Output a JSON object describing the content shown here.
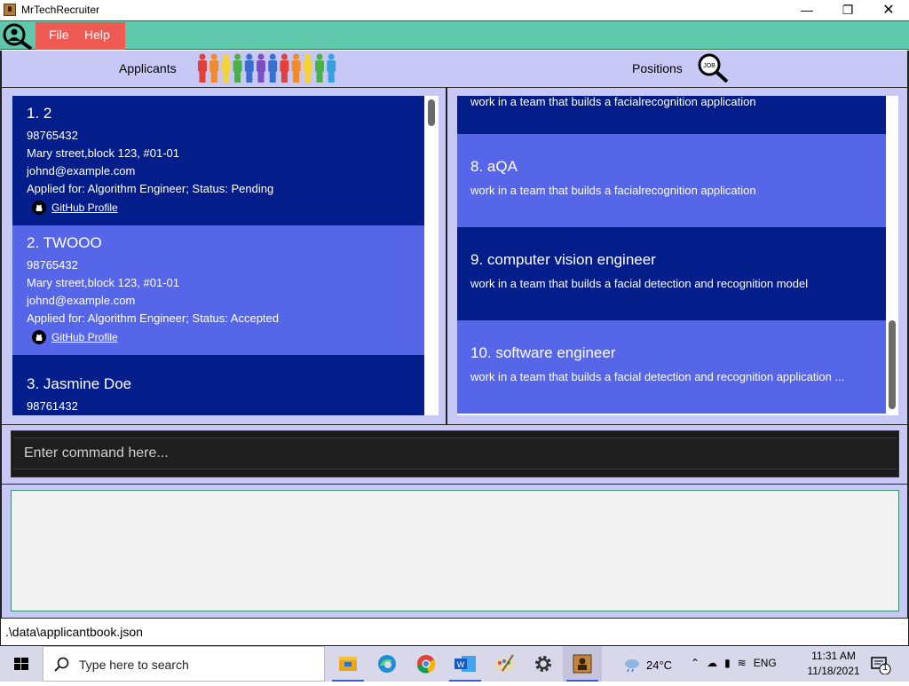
{
  "window": {
    "title": "MrTechRecruiter",
    "icon": "app-icon"
  },
  "menu": {
    "file": "File",
    "help": "Help"
  },
  "headers": {
    "applicants": "Applicants",
    "positions": "Positions",
    "job_icon_text": "JOB"
  },
  "applicants": [
    {
      "heading": "1.  2",
      "phone": "98765432",
      "address": "Mary street,block 123, #01-01",
      "email": "johnd@example.com",
      "applied": "Applied for: Algorithm Engineer; Status: Pending",
      "github": "GitHub Profile"
    },
    {
      "heading": "2.  TWOOO",
      "phone": "98765432",
      "address": "Mary street,block 123, #01-01",
      "email": "johnd@example.com",
      "applied": "Applied for: Algorithm Engineer; Status: Accepted",
      "github": "GitHub Profile"
    },
    {
      "heading": "3.  Jasmine Doe",
      "phone": "98761432"
    }
  ],
  "positions": {
    "partial_top_desc": "work in a team that builds a facialrecognition application",
    "items": [
      {
        "heading": "8.  aQA",
        "desc": "work in a team that builds a facialrecognition application"
      },
      {
        "heading": "9.  computer vision engineer",
        "desc": "work in a team that builds a facial detection and recognition model"
      },
      {
        "heading": "10.  software engineer",
        "desc": "work in a team that builds a facial detection and recognition application ..."
      }
    ]
  },
  "command": {
    "placeholder": "Enter command here..."
  },
  "status": {
    "path": ".\\data\\applicantbook.json"
  },
  "taskbar": {
    "search_placeholder": "Type here to search",
    "weather": "24°C",
    "language": "ENG",
    "time": "11:31 AM",
    "date": "11/18/2021",
    "notifications": "1"
  },
  "colors": {
    "menu_bg": "#5ec8ab",
    "menu_red": "#f05a54",
    "dark_card": "#031d8a",
    "light_card": "#5666e8",
    "panel_bg": "#c7c8f5"
  }
}
